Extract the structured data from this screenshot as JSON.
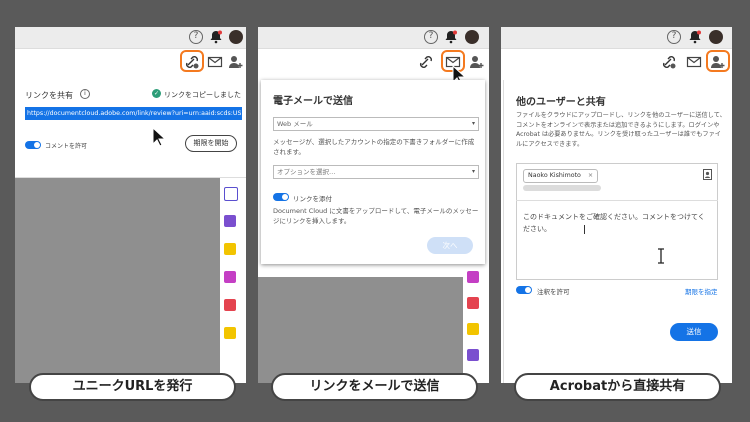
{
  "panel1": {
    "share_heading": "リンクを共有",
    "copied_text": "リンクをコピーしました",
    "url": "https://documentcloud.adobe.com/link/review?uri=urn:aaid:scds:US:5",
    "comments_allow": "コメントを許可",
    "deadline_button": "期限を開始",
    "caption": "ユニークURLを発行"
  },
  "panel2": {
    "title": "電子メールで送信",
    "web_mail": "Web メール",
    "description": "メッセージが、選択したアカウントの指定の下書きフォルダーに作成されます。",
    "option_placeholder": "オプションを選択…",
    "attach_link": "リンクを添付",
    "upload_note": "Document Cloud に文書をアップロードして、電子メールのメッセージにリンクを挿入します。",
    "next_button": "次へ",
    "caption": "リンクをメールで送信"
  },
  "panel3": {
    "title": "他のユーザーと共有",
    "description": "ファイルをクラウドにアップロードし、リンクを他のユーザーに送信して、コメントをオンラインで表示または追加できるようにします。ログインや Acrobat は必要ありません。リンクを受け取ったユーザーは誰でもファイルにアクセスできます。",
    "recipient": "Naoko Kishimoto",
    "message": "このドキュメントをご確認ください。コメントをつけてください。",
    "allow_comments": "注釈を許可",
    "deadline_link": "期限を指定",
    "send_button": "送信",
    "caption": "Acrobatから直接共有"
  },
  "colors": {
    "accent": "#1473e6",
    "highlight": "#f47a20",
    "backdrop": "#5a5a5a"
  }
}
